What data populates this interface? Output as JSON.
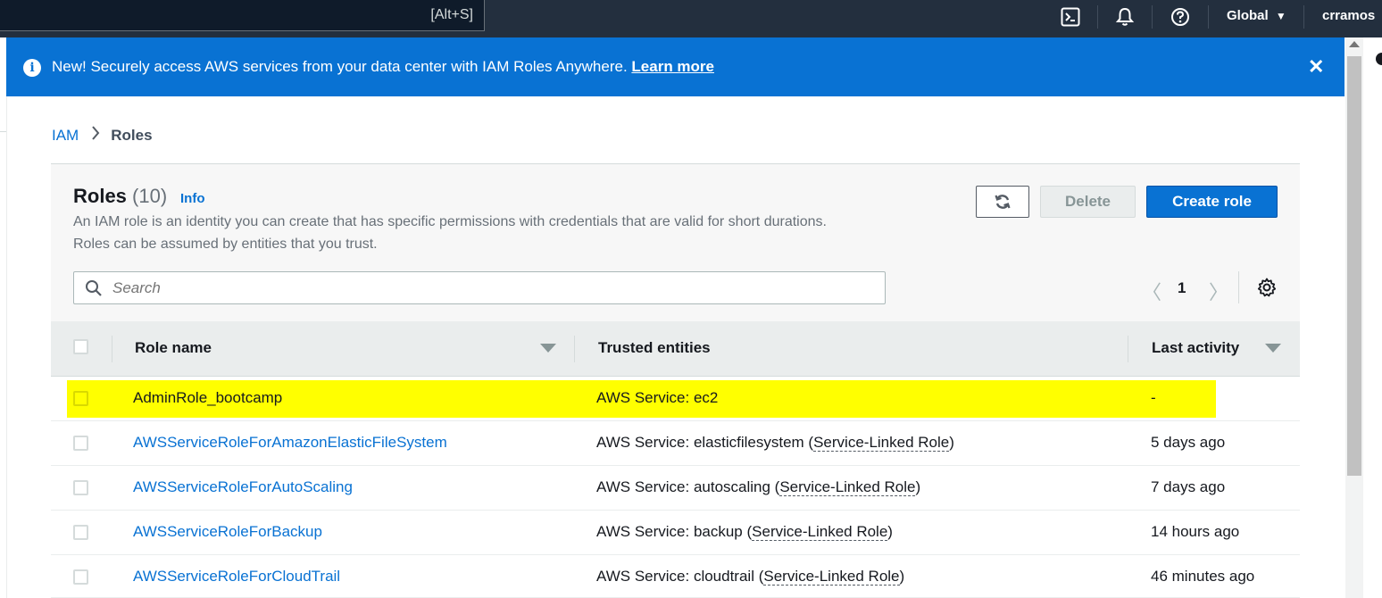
{
  "topnav": {
    "search_shortcut": "[Alt+S]",
    "region": "Global",
    "region_caret": "▼",
    "user": "crramos",
    "user_caret": "▼"
  },
  "flash": {
    "message": "New! Securely access AWS services from your data center with IAM Roles Anywhere.",
    "link": "Learn more",
    "close": "✕"
  },
  "breadcrumb": {
    "parent": "IAM",
    "current": "Roles"
  },
  "header": {
    "title": "Roles",
    "count": "(10)",
    "info": "Info",
    "description": "An IAM role is an identity you can create that has specific permissions with credentials that are valid for short durations. Roles can be assumed by entities that you trust."
  },
  "actions": {
    "delete": "Delete",
    "create": "Create role"
  },
  "search": {
    "placeholder": "Search"
  },
  "pagination": {
    "prev": "〈",
    "page": "1",
    "next": "〉"
  },
  "table": {
    "columns": {
      "name": "Role name",
      "trusted": "Trusted entities",
      "activity": "Last activity"
    },
    "rows": [
      {
        "name": "AdminRole_bootcamp",
        "trusted": "AWS Service: ec2",
        "slr": "",
        "activity": "-"
      },
      {
        "name": "AWSServiceRoleForAmazonElasticFileSystem",
        "trusted": "AWS Service: elasticfilesystem (",
        "slr": "Service-Linked Role",
        "close": ")",
        "activity": "5 days ago"
      },
      {
        "name": "AWSServiceRoleForAutoScaling",
        "trusted": "AWS Service: autoscaling (",
        "slr": "Service-Linked Role",
        "close": ")",
        "activity": "7 days ago"
      },
      {
        "name": "AWSServiceRoleForBackup",
        "trusted": "AWS Service: backup (",
        "slr": "Service-Linked Role",
        "close": ")",
        "activity": "14 hours ago"
      },
      {
        "name": "AWSServiceRoleForCloudTrail",
        "trusted": "AWS Service: cloudtrail (",
        "slr": "Service-Linked Role",
        "close": ")",
        "activity": "46 minutes ago"
      }
    ]
  },
  "colors": {
    "accent": "#0972d3",
    "highlight": "#ffff00",
    "nav": "#232f3e"
  }
}
